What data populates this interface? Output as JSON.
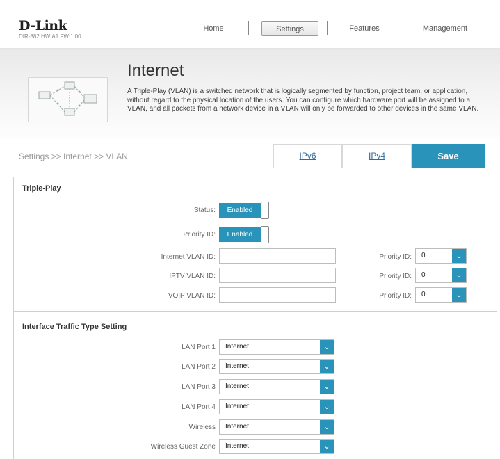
{
  "brand": {
    "logo": "D-Link",
    "model": "DIR-882 HW:A1 FW:1.00"
  },
  "nav": {
    "home": "Home",
    "settings": "Settings",
    "features": "Features",
    "management": "Management"
  },
  "banner": {
    "title": "Internet",
    "description": "A Triple-Play (VLAN) is a switched network that is logically segmented by function, project team, or application, without regard to the physical location of the users. You can configure which hardware port will be assigned to a VLAN, and all packets from a network device in a VLAN will only be forwarded to other devices in the same VLAN."
  },
  "breadcrumb": "Settings >> Internet >> VLAN",
  "tabs": {
    "ipv6": "IPv6",
    "ipv4": "IPv4"
  },
  "save_label": "Save",
  "triple_play": {
    "title": "Triple-Play",
    "status_label": "Status:",
    "status_value": "Enabled",
    "priority_label": "Priority ID:",
    "priority_value": "Enabled",
    "vlans": [
      {
        "label": "Internet VLAN ID:",
        "value": "",
        "priority_label": "Priority ID:",
        "priority_value": "0"
      },
      {
        "label": "IPTV VLAN ID:",
        "value": "",
        "priority_label": "Priority ID:",
        "priority_value": "0"
      },
      {
        "label": "VOIP VLAN ID:",
        "value": "",
        "priority_label": "Priority ID:",
        "priority_value": "0"
      }
    ]
  },
  "interface": {
    "title": "Interface Traffic Type Setting",
    "ports": [
      {
        "label": "LAN Port 1",
        "value": "Internet"
      },
      {
        "label": "LAN Port 2",
        "value": "Internet"
      },
      {
        "label": "LAN Port 3",
        "value": "Internet"
      },
      {
        "label": "LAN Port 4",
        "value": "Internet"
      },
      {
        "label": "Wireless",
        "value": "Internet"
      },
      {
        "label": "Wireless Guest Zone",
        "value": "Internet"
      }
    ]
  },
  "colors": {
    "accent": "#2a93ba",
    "link": "#2e6da4"
  },
  "icons": {
    "dropdown": "chevron-down-icon"
  }
}
